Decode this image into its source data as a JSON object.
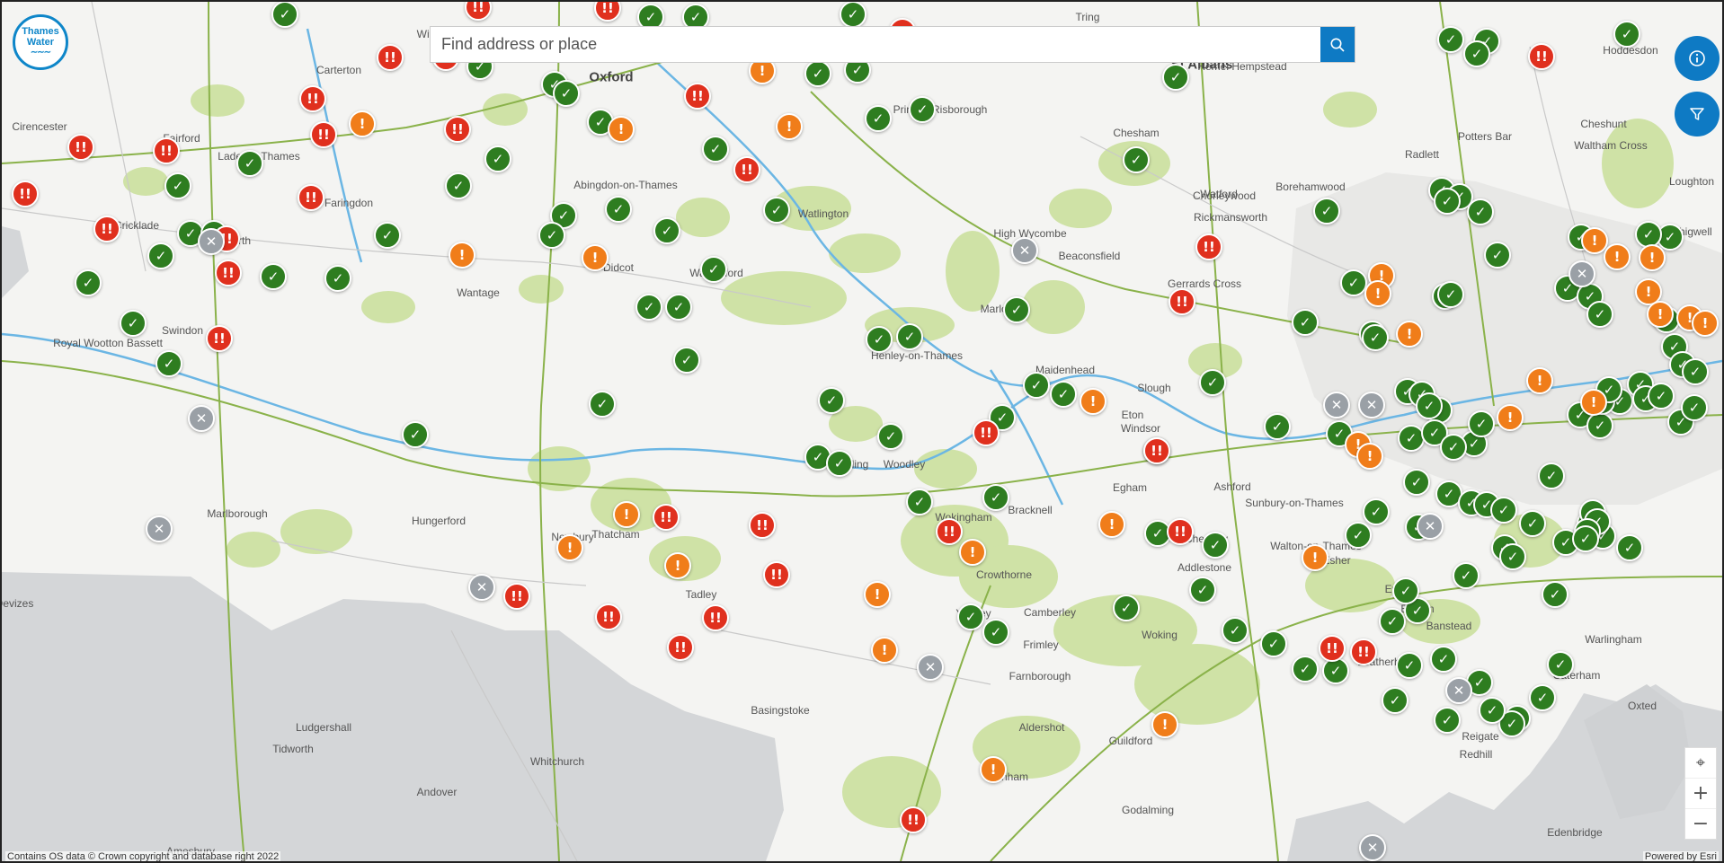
{
  "logo": {
    "line1": "Thames",
    "line2": "Water",
    "waves": "∼∼∼"
  },
  "search": {
    "placeholder": "Find address or place"
  },
  "icons": {
    "search": "search-icon",
    "info": "info-icon",
    "filter": "filter-icon",
    "locate": "locate-icon",
    "zoom_in": "plus-icon",
    "zoom_out": "minus-icon"
  },
  "controls": {
    "zoom_in_label": "+",
    "zoom_out_label": "−",
    "locate_label": "⌖"
  },
  "footer": {
    "attribution": "Contains OS data © Crown copyright and database right 2022",
    "powered": "Powered by Esri"
  },
  "colors": {
    "ok": "#2e7d20",
    "warn": "#f07d1a",
    "alert": "#e0301e",
    "closed": "#9aa0a6",
    "brand": "#0e7ac4",
    "woodland": "#cfe2a6",
    "downland": "#d4d6d8",
    "river": "#6bb6e4",
    "road": "#8ab24a"
  },
  "places": [
    {
      "name": "Oxford",
      "type": "city"
    },
    {
      "name": "St Albans",
      "type": "city"
    },
    {
      "name": "Carterton",
      "type": "town"
    },
    {
      "name": "Cirencester",
      "type": "town"
    },
    {
      "name": "Fairford",
      "type": "town"
    },
    {
      "name": "Lade-on-Thames",
      "type": "town"
    },
    {
      "name": "Faringdon",
      "type": "town"
    },
    {
      "name": "Abingdon-on-Thames",
      "type": "town"
    },
    {
      "name": "Watlington",
      "type": "town"
    },
    {
      "name": "Princes Risborough",
      "type": "town"
    },
    {
      "name": "Hemel Hempstead",
      "type": "town"
    },
    {
      "name": "Hoddesdon",
      "type": "town"
    },
    {
      "name": "Cheshunt",
      "type": "town"
    },
    {
      "name": "Potters Bar",
      "type": "town"
    },
    {
      "name": "Radlett",
      "type": "town"
    },
    {
      "name": "Waltham Cross",
      "type": "town"
    },
    {
      "name": "Loughton",
      "type": "town"
    },
    {
      "name": "Chigwell",
      "type": "town"
    },
    {
      "name": "Chesham",
      "type": "town"
    },
    {
      "name": "Chorleywood",
      "type": "town"
    },
    {
      "name": "Watford",
      "type": "town"
    },
    {
      "name": "Rickmansworth",
      "type": "town"
    },
    {
      "name": "Borehamwood",
      "type": "town"
    },
    {
      "name": "High Wycombe",
      "type": "town"
    },
    {
      "name": "Beaconsfield",
      "type": "town"
    },
    {
      "name": "Gerrards Cross",
      "type": "town"
    },
    {
      "name": "Wantage",
      "type": "town"
    },
    {
      "name": "Didcot",
      "type": "town"
    },
    {
      "name": "Wallingford",
      "type": "town"
    },
    {
      "name": "Swindon",
      "type": "town"
    },
    {
      "name": "Royal Wootton Bassett",
      "type": "town"
    },
    {
      "name": "Marlow",
      "type": "town"
    },
    {
      "name": "Henley-on-Thames",
      "type": "town"
    },
    {
      "name": "Maidenhead",
      "type": "town"
    },
    {
      "name": "Slough",
      "type": "town"
    },
    {
      "name": "Eton",
      "type": "town"
    },
    {
      "name": "Windsor",
      "type": "town"
    },
    {
      "name": "Reading",
      "type": "town"
    },
    {
      "name": "Woodley",
      "type": "town"
    },
    {
      "name": "Wokingham",
      "type": "town"
    },
    {
      "name": "Bracknell",
      "type": "town"
    },
    {
      "name": "Egham",
      "type": "town"
    },
    {
      "name": "Ashford",
      "type": "town"
    },
    {
      "name": "Sunbury-on-Thames",
      "type": "town"
    },
    {
      "name": "Chertsey",
      "type": "town"
    },
    {
      "name": "Addlestone",
      "type": "town"
    },
    {
      "name": "Walton-on-Thames",
      "type": "town"
    },
    {
      "name": "Esher",
      "type": "town"
    },
    {
      "name": "Ewell",
      "type": "town"
    },
    {
      "name": "Epsom",
      "type": "town"
    },
    {
      "name": "Banstead",
      "type": "town"
    },
    {
      "name": "Warlingham",
      "type": "town"
    },
    {
      "name": "Caterham",
      "type": "town"
    },
    {
      "name": "Oxted",
      "type": "town"
    },
    {
      "name": "Reigate",
      "type": "town"
    },
    {
      "name": "Leatherhead",
      "type": "town"
    },
    {
      "name": "Woking",
      "type": "town"
    },
    {
      "name": "Guildford",
      "type": "town"
    },
    {
      "name": "Godalming",
      "type": "town"
    },
    {
      "name": "Farnborough",
      "type": "town"
    },
    {
      "name": "Aldershot",
      "type": "town"
    },
    {
      "name": "Farnham",
      "type": "town"
    },
    {
      "name": "Frimley",
      "type": "town"
    },
    {
      "name": "Camberley",
      "type": "town"
    },
    {
      "name": "Crowthorne",
      "type": "town"
    },
    {
      "name": "Yateley",
      "type": "town"
    },
    {
      "name": "Basingstoke",
      "type": "town"
    },
    {
      "name": "Tadley",
      "type": "town"
    },
    {
      "name": "Thatcham",
      "type": "town"
    },
    {
      "name": "Newbury",
      "type": "town"
    },
    {
      "name": "Hungerford",
      "type": "town"
    },
    {
      "name": "Marlborough",
      "type": "town"
    },
    {
      "name": "Ludgershall",
      "type": "town"
    },
    {
      "name": "Tidworth",
      "type": "town"
    },
    {
      "name": "Andover",
      "type": "town"
    },
    {
      "name": "Whitchurch",
      "type": "town"
    },
    {
      "name": "Amesbury",
      "type": "town"
    },
    {
      "name": "Devizes",
      "type": "town"
    },
    {
      "name": "Tring",
      "type": "town"
    },
    {
      "name": "Highworth",
      "type": "town"
    },
    {
      "name": "Cricklade",
      "type": "town"
    },
    {
      "name": "Redhill",
      "type": "town"
    },
    {
      "name": "Edenbridge",
      "type": "town"
    },
    {
      "name": "Witney",
      "type": "town"
    }
  ],
  "markers": [
    {
      "status": "ok"
    },
    {
      "status": "ok"
    },
    {
      "status": "ok"
    },
    {
      "status": "ok"
    },
    {
      "status": "ok"
    },
    {
      "status": "ok"
    },
    {
      "status": "ok"
    },
    {
      "status": "ok"
    },
    {
      "status": "ok"
    },
    {
      "status": "ok"
    },
    {
      "status": "ok"
    },
    {
      "status": "ok"
    },
    {
      "status": "ok"
    },
    {
      "status": "ok"
    },
    {
      "status": "ok"
    },
    {
      "status": "ok"
    },
    {
      "status": "ok"
    },
    {
      "status": "ok"
    },
    {
      "status": "ok"
    },
    {
      "status": "ok"
    },
    {
      "status": "ok"
    },
    {
      "status": "ok"
    },
    {
      "status": "ok"
    },
    {
      "status": "ok"
    },
    {
      "status": "ok"
    },
    {
      "status": "ok"
    },
    {
      "status": "ok"
    },
    {
      "status": "ok"
    },
    {
      "status": "ok"
    },
    {
      "status": "ok"
    },
    {
      "status": "ok"
    },
    {
      "status": "ok"
    },
    {
      "status": "ok"
    },
    {
      "status": "ok"
    },
    {
      "status": "ok"
    },
    {
      "status": "ok"
    },
    {
      "status": "ok"
    },
    {
      "status": "ok"
    },
    {
      "status": "ok"
    },
    {
      "status": "ok"
    },
    {
      "status": "ok"
    },
    {
      "status": "ok"
    },
    {
      "status": "ok"
    },
    {
      "status": "ok"
    },
    {
      "status": "ok"
    },
    {
      "status": "ok"
    },
    {
      "status": "ok"
    },
    {
      "status": "ok"
    },
    {
      "status": "ok"
    },
    {
      "status": "ok"
    },
    {
      "status": "ok"
    },
    {
      "status": "ok"
    },
    {
      "status": "ok"
    },
    {
      "status": "ok"
    },
    {
      "status": "ok"
    },
    {
      "status": "ok"
    },
    {
      "status": "ok"
    },
    {
      "status": "ok"
    },
    {
      "status": "ok"
    },
    {
      "status": "ok"
    },
    {
      "status": "ok"
    },
    {
      "status": "ok"
    },
    {
      "status": "ok"
    },
    {
      "status": "ok"
    },
    {
      "status": "ok"
    },
    {
      "status": "ok"
    },
    {
      "status": "ok"
    },
    {
      "status": "ok"
    },
    {
      "status": "ok"
    },
    {
      "status": "ok"
    },
    {
      "status": "ok"
    },
    {
      "status": "ok"
    },
    {
      "status": "ok"
    },
    {
      "status": "ok"
    },
    {
      "status": "ok"
    },
    {
      "status": "ok"
    },
    {
      "status": "ok"
    },
    {
      "status": "ok"
    },
    {
      "status": "ok"
    },
    {
      "status": "ok"
    },
    {
      "status": "ok"
    },
    {
      "status": "ok"
    },
    {
      "status": "ok"
    },
    {
      "status": "ok"
    },
    {
      "status": "ok"
    },
    {
      "status": "ok"
    },
    {
      "status": "ok"
    },
    {
      "status": "ok"
    },
    {
      "status": "ok"
    },
    {
      "status": "ok"
    },
    {
      "status": "ok"
    },
    {
      "status": "ok"
    },
    {
      "status": "ok"
    },
    {
      "status": "ok"
    },
    {
      "status": "ok"
    },
    {
      "status": "ok"
    },
    {
      "status": "ok"
    },
    {
      "status": "ok"
    },
    {
      "status": "ok"
    },
    {
      "status": "ok"
    },
    {
      "status": "ok"
    },
    {
      "status": "ok"
    },
    {
      "status": "ok"
    },
    {
      "status": "ok"
    },
    {
      "status": "ok"
    },
    {
      "status": "ok"
    },
    {
      "status": "ok"
    },
    {
      "status": "ok"
    },
    {
      "status": "ok"
    },
    {
      "status": "ok"
    },
    {
      "status": "ok"
    },
    {
      "status": "ok"
    },
    {
      "status": "ok"
    },
    {
      "status": "ok"
    },
    {
      "status": "ok"
    },
    {
      "status": "ok"
    },
    {
      "status": "ok"
    },
    {
      "status": "ok"
    },
    {
      "status": "ok"
    },
    {
      "status": "ok"
    },
    {
      "status": "ok"
    },
    {
      "status": "ok"
    },
    {
      "status": "ok"
    },
    {
      "status": "ok"
    },
    {
      "status": "ok"
    },
    {
      "status": "ok"
    },
    {
      "status": "ok"
    },
    {
      "status": "ok"
    },
    {
      "status": "ok"
    },
    {
      "status": "ok"
    },
    {
      "status": "ok"
    },
    {
      "status": "ok"
    },
    {
      "status": "ok"
    },
    {
      "status": "ok"
    },
    {
      "status": "ok"
    },
    {
      "status": "ok"
    },
    {
      "status": "ok"
    },
    {
      "status": "ok"
    },
    {
      "status": "ok"
    },
    {
      "status": "ok"
    },
    {
      "status": "ok"
    },
    {
      "status": "ok"
    },
    {
      "status": "ok"
    },
    {
      "status": "ok"
    },
    {
      "status": "warn"
    },
    {
      "status": "warn"
    },
    {
      "status": "warn"
    },
    {
      "status": "warn"
    },
    {
      "status": "warn"
    },
    {
      "status": "warn"
    },
    {
      "status": "warn"
    },
    {
      "status": "warn"
    },
    {
      "status": "warn"
    },
    {
      "status": "warn"
    },
    {
      "status": "warn"
    },
    {
      "status": "warn"
    },
    {
      "status": "warn"
    },
    {
      "status": "warn"
    },
    {
      "status": "warn"
    },
    {
      "status": "warn"
    },
    {
      "status": "warn"
    },
    {
      "status": "warn"
    },
    {
      "status": "warn"
    },
    {
      "status": "warn"
    },
    {
      "status": "warn"
    },
    {
      "status": "warn"
    },
    {
      "status": "warn"
    },
    {
      "status": "warn"
    },
    {
      "status": "warn"
    },
    {
      "status": "warn"
    },
    {
      "status": "warn"
    },
    {
      "status": "warn"
    },
    {
      "status": "warn"
    },
    {
      "status": "warn"
    },
    {
      "status": "warn"
    },
    {
      "status": "warn"
    },
    {
      "status": "alert"
    },
    {
      "status": "alert"
    },
    {
      "status": "alert"
    },
    {
      "status": "alert"
    },
    {
      "status": "alert"
    },
    {
      "status": "alert"
    },
    {
      "status": "alert"
    },
    {
      "status": "alert"
    },
    {
      "status": "alert"
    },
    {
      "status": "alert"
    },
    {
      "status": "alert"
    },
    {
      "status": "alert"
    },
    {
      "status": "alert"
    },
    {
      "status": "alert"
    },
    {
      "status": "alert"
    },
    {
      "status": "alert"
    },
    {
      "status": "alert"
    },
    {
      "status": "alert"
    },
    {
      "status": "alert"
    },
    {
      "status": "alert"
    },
    {
      "status": "alert"
    },
    {
      "status": "alert"
    },
    {
      "status": "alert"
    },
    {
      "status": "alert"
    },
    {
      "status": "alert"
    },
    {
      "status": "alert"
    },
    {
      "status": "alert"
    },
    {
      "status": "alert"
    },
    {
      "status": "alert"
    },
    {
      "status": "alert"
    },
    {
      "status": "alert"
    },
    {
      "status": "alert"
    },
    {
      "status": "alert"
    },
    {
      "status": "alert"
    },
    {
      "status": "alert"
    },
    {
      "status": "alert"
    },
    {
      "status": "closed"
    },
    {
      "status": "closed"
    },
    {
      "status": "closed"
    },
    {
      "status": "closed"
    },
    {
      "status": "closed"
    },
    {
      "status": "closed"
    },
    {
      "status": "closed"
    },
    {
      "status": "closed"
    },
    {
      "status": "closed"
    },
    {
      "status": "closed"
    },
    {
      "status": "closed"
    },
    {
      "status": "closed"
    }
  ],
  "marker_glyphs": {
    "ok": "✓",
    "warn": "!",
    "alert": "!!",
    "closed": "✕"
  }
}
